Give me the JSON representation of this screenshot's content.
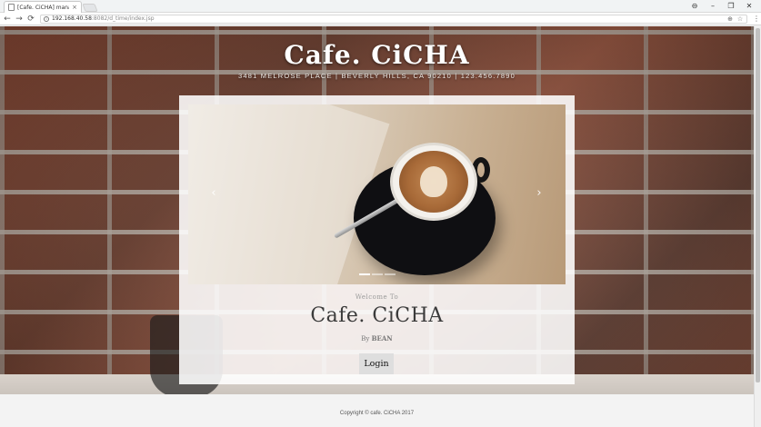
{
  "browser": {
    "tab_title": "[Cafe. CiCHA] manage",
    "tab_close": "×",
    "win_controls": [
      "⊖",
      "–",
      "❐",
      "✕"
    ],
    "nav": {
      "back": "←",
      "forward": "→",
      "reload": "⟳"
    },
    "url_host": "192.168.40.58",
    "url_path": ":8082/d_time/index.jsp",
    "zoom_icon": "⊕",
    "star_icon": "☆",
    "menu_icon": "⋮"
  },
  "header": {
    "title": "Cafe. CiCHA",
    "address": "3481 MELROSE PLACE | BEVERLY HILLS, CA 90210 | 123.456.7890"
  },
  "carousel": {
    "prev": "‹",
    "next": "›",
    "indicator_count": 3,
    "active_index": 0
  },
  "intro": {
    "welcome": "Welcome To",
    "title": "Cafe. CiCHA",
    "by_prefix": "By",
    "by_name": "BEAN",
    "login_label": "Login"
  },
  "footer": {
    "copyright": "Copyright © cafe. CiCHA 2017"
  },
  "colors": {
    "brick": "#8c4a36",
    "panel": "#ffffff",
    "button": "#dedede"
  }
}
